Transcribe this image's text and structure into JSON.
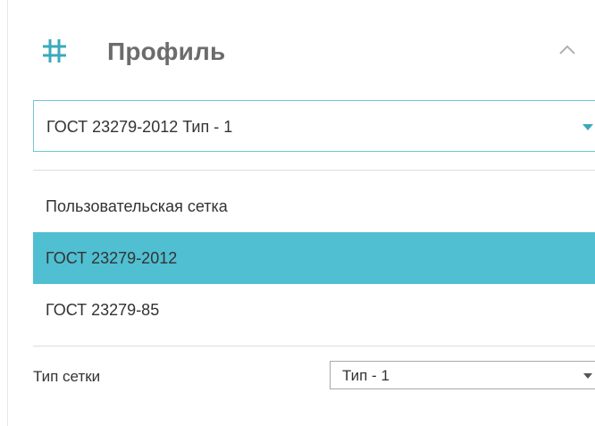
{
  "header": {
    "title": "Профиль",
    "icon": "grid-icon",
    "collapse_icon": "chevron-up-icon",
    "icon_color": "#3aa9bd"
  },
  "profile_select": {
    "value": "ГОСТ 23279-2012 Тип - 1",
    "accent_color": "#6fc7d3"
  },
  "dropdown": {
    "items": [
      {
        "label": "Пользовательская сетка",
        "selected": false
      },
      {
        "label": "ГОСТ 23279-2012",
        "selected": true
      },
      {
        "label": "ГОСТ 23279-85",
        "selected": false
      }
    ],
    "selected_color": "#50bfd2"
  },
  "grid_type": {
    "label": "Тип сетки",
    "value": "Тип - 1"
  }
}
